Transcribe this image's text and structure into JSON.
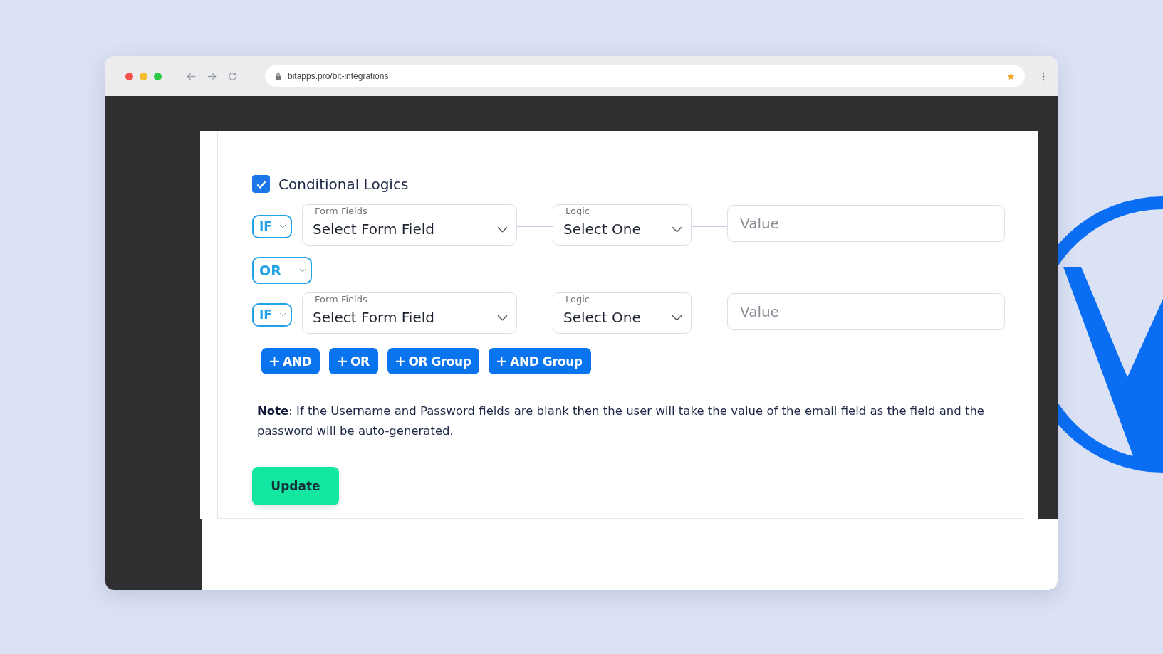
{
  "browser": {
    "url": "bitapps.pro/bit-integrations"
  },
  "conditional_logics": {
    "label": "Conditional Logics",
    "checked": true
  },
  "conditions": [
    {
      "kind": "rule",
      "operator": "IF",
      "field_label": "Form Fields",
      "field_value": "Select Form Field",
      "logic_label": "Logic",
      "logic_value": "Select One",
      "value_placeholder": "Value"
    },
    {
      "kind": "joiner",
      "operator": "OR"
    },
    {
      "kind": "rule",
      "operator": "IF",
      "field_label": "Form Fields",
      "field_value": "Select Form Field",
      "logic_label": "Logic",
      "logic_value": "Select One",
      "value_placeholder": "Value"
    }
  ],
  "add_buttons": [
    "AND",
    "OR",
    "OR Group",
    "AND Group"
  ],
  "note": "**Note**: If the Username and Password fields are blank then the user will take the value of the email field as the field and the password will be auto-generated.",
  "update_button": "Update"
}
